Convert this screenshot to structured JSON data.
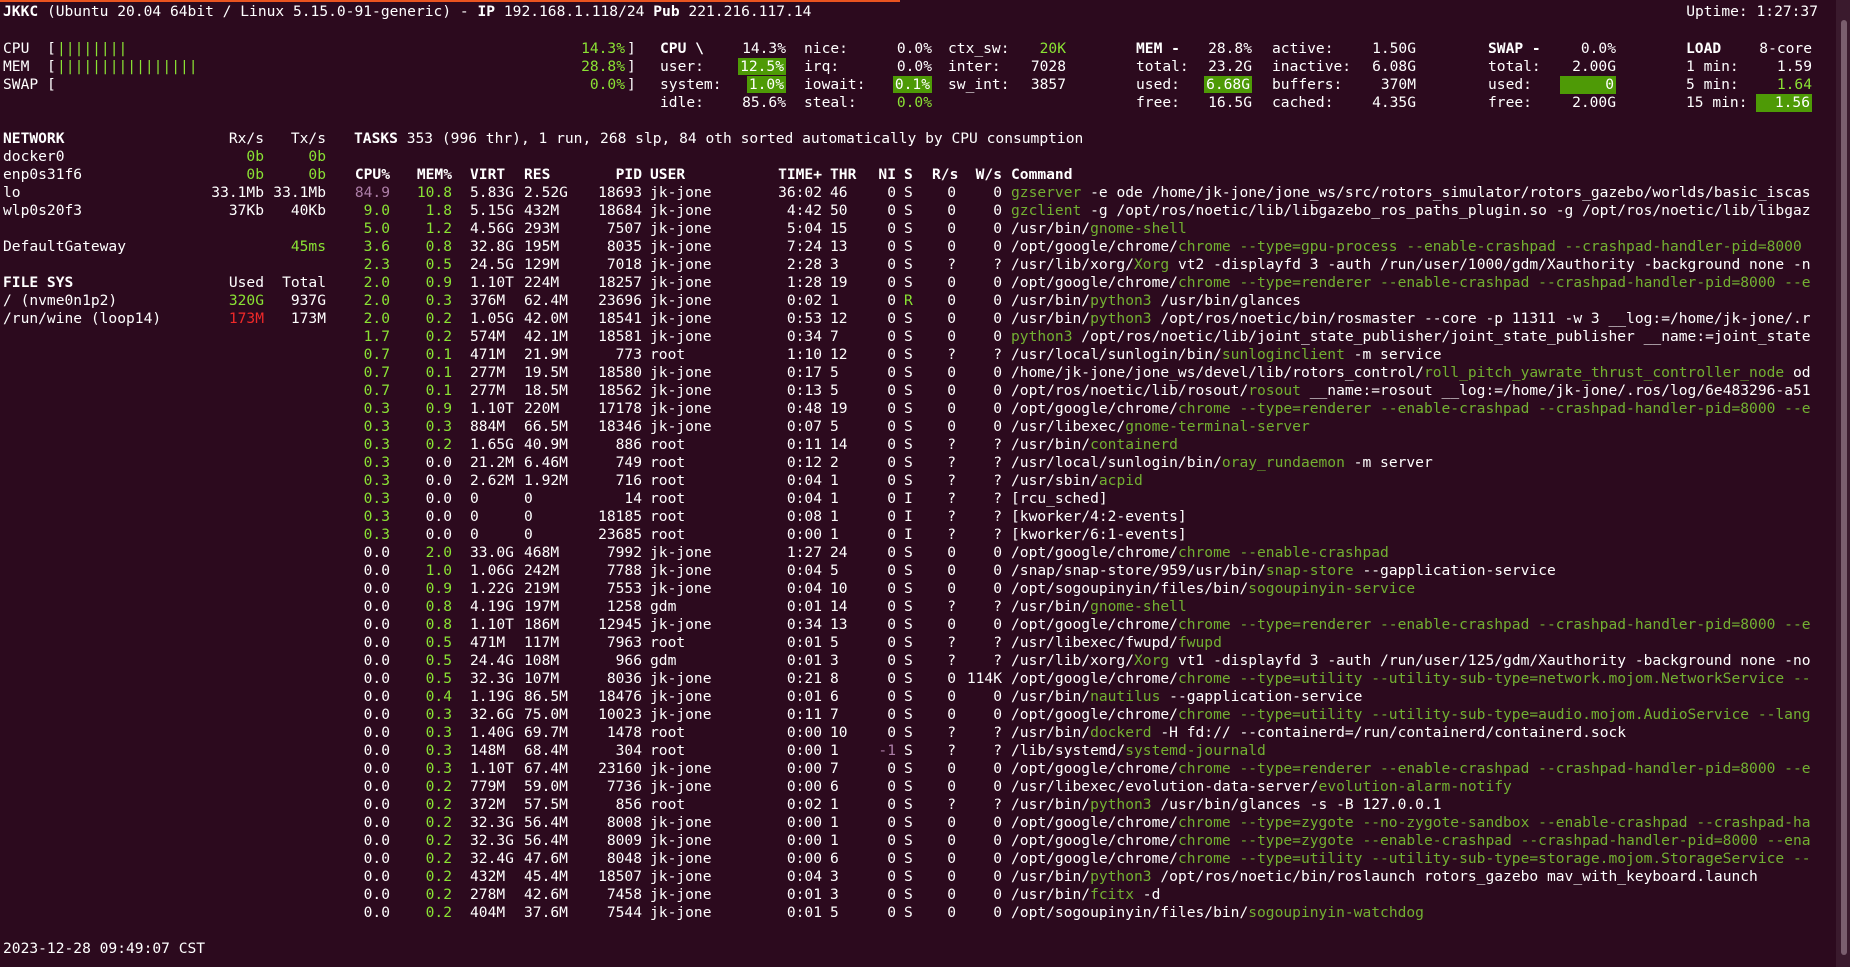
{
  "header": {
    "host": "JKKC",
    "os": "(Ubuntu 20.04 64bit / Linux 5.15.0-91-generic) -",
    "ip_label": "IP",
    "ip": "192.168.1.118/24",
    "pub_label": "Pub",
    "pub": "221.216.117.14",
    "uptime": "Uptime: 1:27:37"
  },
  "bars": [
    {
      "label": "CPU",
      "bar": "||||||||",
      "pct": "14.3%"
    },
    {
      "label": "MEM",
      "bar": "||||||||||||||||",
      "pct": "28.8%"
    },
    {
      "label": "SWAP",
      "bar": "",
      "pct": "0.0%"
    }
  ],
  "cpu": {
    "title": "CPU \\",
    "total": "14.3%",
    "user_l": "user:",
    "user": "12.5%",
    "system_l": "system:",
    "system": "1.0%",
    "idle_l": "idle:",
    "idle": "85.6%",
    "nice_l": "nice:",
    "nice": "0.0%",
    "irq_l": "irq:",
    "irq": "0.0%",
    "iowait_l": "iowait:",
    "iowait": "0.1%",
    "steal_l": "steal:",
    "steal": "0.0%",
    "ctx_l": "ctx_sw:",
    "ctx": "20K",
    "inter_l": "inter:",
    "inter": "7028",
    "swint_l": "sw_int:",
    "swint": "3857"
  },
  "mem": {
    "title": "MEM -",
    "pct": "28.8%",
    "total_l": "total:",
    "total": "23.2G",
    "used_l": "used:",
    "used": "6.68G",
    "free_l": "free:",
    "free": "16.5G",
    "active_l": "active:",
    "active": "1.50G",
    "inactive_l": "inactive:",
    "inactive": "6.08G",
    "buffers_l": "buffers:",
    "buffers": "370M",
    "cached_l": "cached:",
    "cached": "4.35G"
  },
  "swap": {
    "title": "SWAP -",
    "pct": "0.0%",
    "total_l": "total:",
    "total": "2.00G",
    "used_l": "used:",
    "used": "0",
    "free_l": "free:",
    "free": "2.00G"
  },
  "load": {
    "title": "LOAD",
    "cores": "8-core",
    "m1_l": "1 min:",
    "m1": "1.59",
    "m5_l": "5 min:",
    "m5": "1.64",
    "m15_l": "15 min:",
    "m15": "1.56"
  },
  "network": {
    "title": "NETWORK",
    "rx": "Rx/s",
    "tx": "Tx/s",
    "rows": [
      {
        "name": "docker0",
        "rx": "0b",
        "tx": "0b"
      },
      {
        "name": "enp0s31f6",
        "rx": "0b",
        "tx": "0b"
      },
      {
        "name": "lo",
        "rx": "33.1Mb",
        "tx": "33.1Mb"
      },
      {
        "name": "wlp0s20f3",
        "rx": "37Kb",
        "tx": "40Kb"
      }
    ],
    "gateway": "DefaultGateway",
    "gateway_val": "45ms"
  },
  "filesys": {
    "title": "FILE SYS",
    "used": "Used",
    "total": "Total",
    "rows": [
      {
        "name": "/ (nvme0n1p2)",
        "used": "320G",
        "total": "937G"
      },
      {
        "name": "/run/wine (loop14)",
        "used": "173M",
        "total": "173M"
      }
    ]
  },
  "tasks": {
    "label": "TASKS",
    "summary": "353 (996 thr), 1 run, 268 slp, 84 oth sorted automatically by CPU consumption"
  },
  "columns": [
    "CPU%",
    "MEM%",
    "VIRT",
    "RES",
    "PID",
    "USER",
    "TIME+",
    "THR",
    "NI",
    "S",
    "R/s",
    "W/s",
    "Command"
  ],
  "processes": [
    {
      "cpu": "84.9",
      "mem": "10.8",
      "virt": "5.83G",
      "res": "2.52G",
      "pid": "18693",
      "user": "jk-jone",
      "time": "36:02",
      "thr": "46",
      "ni": "0",
      "s": "S",
      "rs": "0",
      "ws": "0",
      "cmd_pre": "",
      "cmd_hl": "gzserver",
      "cmd_post": " -e ode /home/jk-jone/jone_ws/src/rotors_simulator/rotors_gazebo/worlds/basic_iscas"
    },
    {
      "cpu": "9.0",
      "mem": "1.8",
      "virt": "5.15G",
      "res": "432M",
      "pid": "18684",
      "user": "jk-jone",
      "time": "4:42",
      "thr": "50",
      "ni": "0",
      "s": "S",
      "rs": "0",
      "ws": "0",
      "cmd_pre": "",
      "cmd_hl": "gzclient",
      "cmd_post": " -g /opt/ros/noetic/lib/libgazebo_ros_paths_plugin.so -g /opt/ros/noetic/lib/libgaz"
    },
    {
      "cpu": "5.0",
      "mem": "1.2",
      "virt": "4.56G",
      "res": "293M",
      "pid": "7507",
      "user": "jk-jone",
      "time": "5:04",
      "thr": "15",
      "ni": "0",
      "s": "S",
      "rs": "0",
      "ws": "0",
      "cmd_pre": "/usr/bin/",
      "cmd_hl": "gnome-shell",
      "cmd_post": ""
    },
    {
      "cpu": "3.6",
      "mem": "0.8",
      "virt": "32.8G",
      "res": "195M",
      "pid": "8035",
      "user": "jk-jone",
      "time": "7:24",
      "thr": "13",
      "ni": "0",
      "s": "S",
      "rs": "0",
      "ws": "0",
      "cmd_pre": "/opt/google/chrome/",
      "cmd_hl": "chrome --type=gpu-process --enable-crashpad --crashpad-handler-pid=8000",
      "cmd_post": ""
    },
    {
      "cpu": "2.3",
      "mem": "0.5",
      "virt": "24.5G",
      "res": "129M",
      "pid": "7018",
      "user": "jk-jone",
      "time": "2:28",
      "thr": "3",
      "ni": "0",
      "s": "S",
      "rs": "?",
      "ws": "?",
      "cmd_pre": "/usr/lib/xorg/",
      "cmd_hl": "Xorg",
      "cmd_post": " vt2 -displayfd 3 -auth /run/user/1000/gdm/Xauthority -background none -n"
    },
    {
      "cpu": "2.0",
      "mem": "0.9",
      "virt": "1.10T",
      "res": "224M",
      "pid": "18257",
      "user": "jk-jone",
      "time": "1:28",
      "thr": "19",
      "ni": "0",
      "s": "S",
      "rs": "0",
      "ws": "0",
      "cmd_pre": "/opt/google/chrome/",
      "cmd_hl": "chrome --type=renderer --enable-crashpad --crashpad-handler-pid=8000 --e",
      "cmd_post": ""
    },
    {
      "cpu": "2.0",
      "mem": "0.3",
      "virt": "376M",
      "res": "62.4M",
      "pid": "23696",
      "user": "jk-jone",
      "time": "0:02",
      "thr": "1",
      "ni": "0",
      "s": "R",
      "rs": "0",
      "ws": "0",
      "cmd_pre": "/usr/bin/",
      "cmd_hl": "python3",
      "cmd_post": " /usr/bin/glances"
    },
    {
      "cpu": "2.0",
      "mem": "0.2",
      "virt": "1.05G",
      "res": "42.0M",
      "pid": "18541",
      "user": "jk-jone",
      "time": "0:53",
      "thr": "12",
      "ni": "0",
      "s": "S",
      "rs": "0",
      "ws": "0",
      "cmd_pre": "/usr/bin/",
      "cmd_hl": "python3",
      "cmd_post": " /opt/ros/noetic/bin/rosmaster --core -p 11311 -w 3 __log:=/home/jk-jone/.r"
    },
    {
      "cpu": "1.7",
      "mem": "0.2",
      "virt": "574M",
      "res": "42.1M",
      "pid": "18581",
      "user": "jk-jone",
      "time": "0:34",
      "thr": "7",
      "ni": "0",
      "s": "S",
      "rs": "0",
      "ws": "0",
      "cmd_pre": "",
      "cmd_hl": "python3",
      "cmd_post": " /opt/ros/noetic/lib/joint_state_publisher/joint_state_publisher __name:=joint_state"
    },
    {
      "cpu": "0.7",
      "mem": "0.1",
      "virt": "471M",
      "res": "21.9M",
      "pid": "773",
      "user": "root",
      "time": "1:10",
      "thr": "12",
      "ni": "0",
      "s": "S",
      "rs": "?",
      "ws": "?",
      "cmd_pre": "/usr/local/sunlogin/bin/",
      "cmd_hl": "sunloginclient",
      "cmd_post": " -m service"
    },
    {
      "cpu": "0.7",
      "mem": "0.1",
      "virt": "277M",
      "res": "19.5M",
      "pid": "18580",
      "user": "jk-jone",
      "time": "0:17",
      "thr": "5",
      "ni": "0",
      "s": "S",
      "rs": "0",
      "ws": "0",
      "cmd_pre": "/home/jk-jone/jone_ws/devel/lib/rotors_control/",
      "cmd_hl": "roll_pitch_yawrate_thrust_controller_node",
      "cmd_post": " od"
    },
    {
      "cpu": "0.7",
      "mem": "0.1",
      "virt": "277M",
      "res": "18.5M",
      "pid": "18562",
      "user": "jk-jone",
      "time": "0:13",
      "thr": "5",
      "ni": "0",
      "s": "S",
      "rs": "0",
      "ws": "0",
      "cmd_pre": "/opt/ros/noetic/lib/rosout/",
      "cmd_hl": "rosout",
      "cmd_post": " __name:=rosout __log:=/home/jk-jone/.ros/log/6e483296-a51"
    },
    {
      "cpu": "0.3",
      "mem": "0.9",
      "virt": "1.10T",
      "res": "220M",
      "pid": "17178",
      "user": "jk-jone",
      "time": "0:48",
      "thr": "19",
      "ni": "0",
      "s": "S",
      "rs": "0",
      "ws": "0",
      "cmd_pre": "/opt/google/chrome/",
      "cmd_hl": "chrome --type=renderer --enable-crashpad --crashpad-handler-pid=8000 --e",
      "cmd_post": ""
    },
    {
      "cpu": "0.3",
      "mem": "0.3",
      "virt": "884M",
      "res": "66.5M",
      "pid": "18346",
      "user": "jk-jone",
      "time": "0:07",
      "thr": "5",
      "ni": "0",
      "s": "S",
      "rs": "0",
      "ws": "0",
      "cmd_pre": "/usr/libexec/",
      "cmd_hl": "gnome-terminal-server",
      "cmd_post": ""
    },
    {
      "cpu": "0.3",
      "mem": "0.2",
      "virt": "1.65G",
      "res": "40.9M",
      "pid": "886",
      "user": "root",
      "time": "0:11",
      "thr": "14",
      "ni": "0",
      "s": "S",
      "rs": "?",
      "ws": "?",
      "cmd_pre": "/usr/bin/",
      "cmd_hl": "containerd",
      "cmd_post": ""
    },
    {
      "cpu": "0.3",
      "mem": "0.0",
      "virt": "21.2M",
      "res": "6.46M",
      "pid": "749",
      "user": "root",
      "time": "0:12",
      "thr": "2",
      "ni": "0",
      "s": "S",
      "rs": "?",
      "ws": "?",
      "cmd_pre": "/usr/local/sunlogin/bin/",
      "cmd_hl": "oray_rundaemon",
      "cmd_post": " -m server"
    },
    {
      "cpu": "0.3",
      "mem": "0.0",
      "virt": "2.62M",
      "res": "1.92M",
      "pid": "716",
      "user": "root",
      "time": "0:04",
      "thr": "1",
      "ni": "0",
      "s": "S",
      "rs": "?",
      "ws": "?",
      "cmd_pre": "/usr/sbin/",
      "cmd_hl": "acpid",
      "cmd_post": ""
    },
    {
      "cpu": "0.3",
      "mem": "0.0",
      "virt": "0",
      "res": "0",
      "pid": "14",
      "user": "root",
      "time": "0:04",
      "thr": "1",
      "ni": "0",
      "s": "I",
      "rs": "?",
      "ws": "?",
      "cmd_pre": "[rcu_sched]",
      "cmd_hl": "",
      "cmd_post": ""
    },
    {
      "cpu": "0.3",
      "mem": "0.0",
      "virt": "0",
      "res": "0",
      "pid": "18185",
      "user": "root",
      "time": "0:08",
      "thr": "1",
      "ni": "0",
      "s": "I",
      "rs": "?",
      "ws": "?",
      "cmd_pre": "[kworker/4:2-events]",
      "cmd_hl": "",
      "cmd_post": ""
    },
    {
      "cpu": "0.3",
      "mem": "0.0",
      "virt": "0",
      "res": "0",
      "pid": "23685",
      "user": "root",
      "time": "0:00",
      "thr": "1",
      "ni": "0",
      "s": "I",
      "rs": "?",
      "ws": "?",
      "cmd_pre": "[kworker/6:1-events]",
      "cmd_hl": "",
      "cmd_post": ""
    },
    {
      "cpu": "0.0",
      "mem": "2.0",
      "virt": "33.0G",
      "res": "468M",
      "pid": "7992",
      "user": "jk-jone",
      "time": "1:27",
      "thr": "24",
      "ni": "0",
      "s": "S",
      "rs": "0",
      "ws": "0",
      "cmd_pre": "/opt/google/chrome/",
      "cmd_hl": "chrome --enable-crashpad",
      "cmd_post": ""
    },
    {
      "cpu": "0.0",
      "mem": "1.0",
      "virt": "1.06G",
      "res": "242M",
      "pid": "7788",
      "user": "jk-jone",
      "time": "0:04",
      "thr": "5",
      "ni": "0",
      "s": "S",
      "rs": "0",
      "ws": "0",
      "cmd_pre": "/snap/snap-store/959/usr/bin/",
      "cmd_hl": "snap-store",
      "cmd_post": " --gapplication-service"
    },
    {
      "cpu": "0.0",
      "mem": "0.9",
      "virt": "1.22G",
      "res": "219M",
      "pid": "7553",
      "user": "jk-jone",
      "time": "0:04",
      "thr": "10",
      "ni": "0",
      "s": "S",
      "rs": "0",
      "ws": "0",
      "cmd_pre": "/opt/sogoupinyin/files/bin/",
      "cmd_hl": "sogoupinyin-service",
      "cmd_post": ""
    },
    {
      "cpu": "0.0",
      "mem": "0.8",
      "virt": "4.19G",
      "res": "197M",
      "pid": "1258",
      "user": "gdm",
      "time": "0:01",
      "thr": "14",
      "ni": "0",
      "s": "S",
      "rs": "?",
      "ws": "?",
      "cmd_pre": "/usr/bin/",
      "cmd_hl": "gnome-shell",
      "cmd_post": ""
    },
    {
      "cpu": "0.0",
      "mem": "0.8",
      "virt": "1.10T",
      "res": "186M",
      "pid": "12945",
      "user": "jk-jone",
      "time": "0:34",
      "thr": "13",
      "ni": "0",
      "s": "S",
      "rs": "0",
      "ws": "0",
      "cmd_pre": "/opt/google/chrome/",
      "cmd_hl": "chrome --type=renderer --enable-crashpad --crashpad-handler-pid=8000 --e",
      "cmd_post": ""
    },
    {
      "cpu": "0.0",
      "mem": "0.5",
      "virt": "471M",
      "res": "117M",
      "pid": "7963",
      "user": "root",
      "time": "0:01",
      "thr": "5",
      "ni": "0",
      "s": "S",
      "rs": "?",
      "ws": "?",
      "cmd_pre": "/usr/libexec/fwupd/",
      "cmd_hl": "fwupd",
      "cmd_post": ""
    },
    {
      "cpu": "0.0",
      "mem": "0.5",
      "virt": "24.4G",
      "res": "108M",
      "pid": "966",
      "user": "gdm",
      "time": "0:01",
      "thr": "3",
      "ni": "0",
      "s": "S",
      "rs": "?",
      "ws": "?",
      "cmd_pre": "/usr/lib/xorg/",
      "cmd_hl": "Xorg",
      "cmd_post": " vt1 -displayfd 3 -auth /run/user/125/gdm/Xauthority -background none -no"
    },
    {
      "cpu": "0.0",
      "mem": "0.5",
      "virt": "32.3G",
      "res": "107M",
      "pid": "8036",
      "user": "jk-jone",
      "time": "0:21",
      "thr": "8",
      "ni": "0",
      "s": "S",
      "rs": "0",
      "ws": "114K",
      "cmd_pre": "/opt/google/chrome/",
      "cmd_hl": "chrome --type=utility --utility-sub-type=network.mojom.NetworkService --",
      "cmd_post": ""
    },
    {
      "cpu": "0.0",
      "mem": "0.4",
      "virt": "1.19G",
      "res": "86.5M",
      "pid": "18476",
      "user": "jk-jone",
      "time": "0:01",
      "thr": "6",
      "ni": "0",
      "s": "S",
      "rs": "0",
      "ws": "0",
      "cmd_pre": "/usr/bin/",
      "cmd_hl": "nautilus",
      "cmd_post": " --gapplication-service"
    },
    {
      "cpu": "0.0",
      "mem": "0.3",
      "virt": "32.6G",
      "res": "75.0M",
      "pid": "10023",
      "user": "jk-jone",
      "time": "0:11",
      "thr": "7",
      "ni": "0",
      "s": "S",
      "rs": "0",
      "ws": "0",
      "cmd_pre": "/opt/google/chrome/",
      "cmd_hl": "chrome --type=utility --utility-sub-type=audio.mojom.AudioService --lang",
      "cmd_post": ""
    },
    {
      "cpu": "0.0",
      "mem": "0.3",
      "virt": "1.40G",
      "res": "69.7M",
      "pid": "1478",
      "user": "root",
      "time": "0:00",
      "thr": "10",
      "ni": "0",
      "s": "S",
      "rs": "?",
      "ws": "?",
      "cmd_pre": "/usr/bin/",
      "cmd_hl": "dockerd",
      "cmd_post": " -H fd:// --containerd=/run/containerd/containerd.sock"
    },
    {
      "cpu": "0.0",
      "mem": "0.3",
      "virt": "148M",
      "res": "68.4M",
      "pid": "304",
      "user": "root",
      "time": "0:00",
      "thr": "1",
      "ni": "-1",
      "s": "S",
      "rs": "?",
      "ws": "?",
      "cmd_pre": "/lib/systemd/",
      "cmd_hl": "systemd-journald",
      "cmd_post": ""
    },
    {
      "cpu": "0.0",
      "mem": "0.3",
      "virt": "1.10T",
      "res": "67.4M",
      "pid": "23160",
      "user": "jk-jone",
      "time": "0:00",
      "thr": "7",
      "ni": "0",
      "s": "S",
      "rs": "0",
      "ws": "0",
      "cmd_pre": "/opt/google/chrome/",
      "cmd_hl": "chrome --type=renderer --enable-crashpad --crashpad-handler-pid=8000 --e",
      "cmd_post": ""
    },
    {
      "cpu": "0.0",
      "mem": "0.2",
      "virt": "779M",
      "res": "59.0M",
      "pid": "7736",
      "user": "jk-jone",
      "time": "0:00",
      "thr": "6",
      "ni": "0",
      "s": "S",
      "rs": "0",
      "ws": "0",
      "cmd_pre": "/usr/libexec/evolution-data-server/",
      "cmd_hl": "evolution-alarm-notify",
      "cmd_post": ""
    },
    {
      "cpu": "0.0",
      "mem": "0.2",
      "virt": "372M",
      "res": "57.5M",
      "pid": "856",
      "user": "root",
      "time": "0:02",
      "thr": "1",
      "ni": "0",
      "s": "S",
      "rs": "?",
      "ws": "?",
      "cmd_pre": "/usr/bin/",
      "cmd_hl": "python3",
      "cmd_post": " /usr/bin/glances -s -B 127.0.0.1"
    },
    {
      "cpu": "0.0",
      "mem": "0.2",
      "virt": "32.3G",
      "res": "56.4M",
      "pid": "8008",
      "user": "jk-jone",
      "time": "0:00",
      "thr": "1",
      "ni": "0",
      "s": "S",
      "rs": "0",
      "ws": "0",
      "cmd_pre": "/opt/google/chrome/",
      "cmd_hl": "chrome --type=zygote --no-zygote-sandbox --enable-crashpad --crashpad-ha",
      "cmd_post": ""
    },
    {
      "cpu": "0.0",
      "mem": "0.2",
      "virt": "32.3G",
      "res": "56.4M",
      "pid": "8009",
      "user": "jk-jone",
      "time": "0:00",
      "thr": "1",
      "ni": "0",
      "s": "S",
      "rs": "0",
      "ws": "0",
      "cmd_pre": "/opt/google/chrome/",
      "cmd_hl": "chrome --type=zygote --enable-crashpad --crashpad-handler-pid=8000 --ena",
      "cmd_post": ""
    },
    {
      "cpu": "0.0",
      "mem": "0.2",
      "virt": "32.4G",
      "res": "47.6M",
      "pid": "8048",
      "user": "jk-jone",
      "time": "0:00",
      "thr": "6",
      "ni": "0",
      "s": "S",
      "rs": "0",
      "ws": "0",
      "cmd_pre": "/opt/google/chrome/",
      "cmd_hl": "chrome --type=utility --utility-sub-type=storage.mojom.StorageService --",
      "cmd_post": ""
    },
    {
      "cpu": "0.0",
      "mem": "0.2",
      "virt": "432M",
      "res": "45.4M",
      "pid": "18507",
      "user": "jk-jone",
      "time": "0:04",
      "thr": "3",
      "ni": "0",
      "s": "S",
      "rs": "0",
      "ws": "0",
      "cmd_pre": "/usr/bin/",
      "cmd_hl": "python3",
      "cmd_post": " /opt/ros/noetic/bin/roslaunch rotors_gazebo mav_with_keyboard.launch"
    },
    {
      "cpu": "0.0",
      "mem": "0.2",
      "virt": "278M",
      "res": "42.6M",
      "pid": "7458",
      "user": "jk-jone",
      "time": "0:01",
      "thr": "3",
      "ni": "0",
      "s": "S",
      "rs": "0",
      "ws": "0",
      "cmd_pre": "/usr/bin/",
      "cmd_hl": "fcitx",
      "cmd_post": " -d"
    },
    {
      "cpu": "0.0",
      "mem": "0.2",
      "virt": "404M",
      "res": "37.6M",
      "pid": "7544",
      "user": "jk-jone",
      "time": "0:01",
      "thr": "5",
      "ni": "0",
      "s": "S",
      "rs": "0",
      "ws": "0",
      "cmd_pre": "/opt/sogoupinyin/files/bin/",
      "cmd_hl": "sogoupinyin-watchdog",
      "cmd_post": ""
    }
  ],
  "footer": {
    "datetime": "2023-12-28 09:49:07 CST"
  },
  "colors": {
    "background": "#2c0a1e",
    "accent_green": "#8ae234",
    "highlight_green": "#4e9a06",
    "alert_red": "#ef2929",
    "top_cpu_purple": "#ad7fa8"
  }
}
